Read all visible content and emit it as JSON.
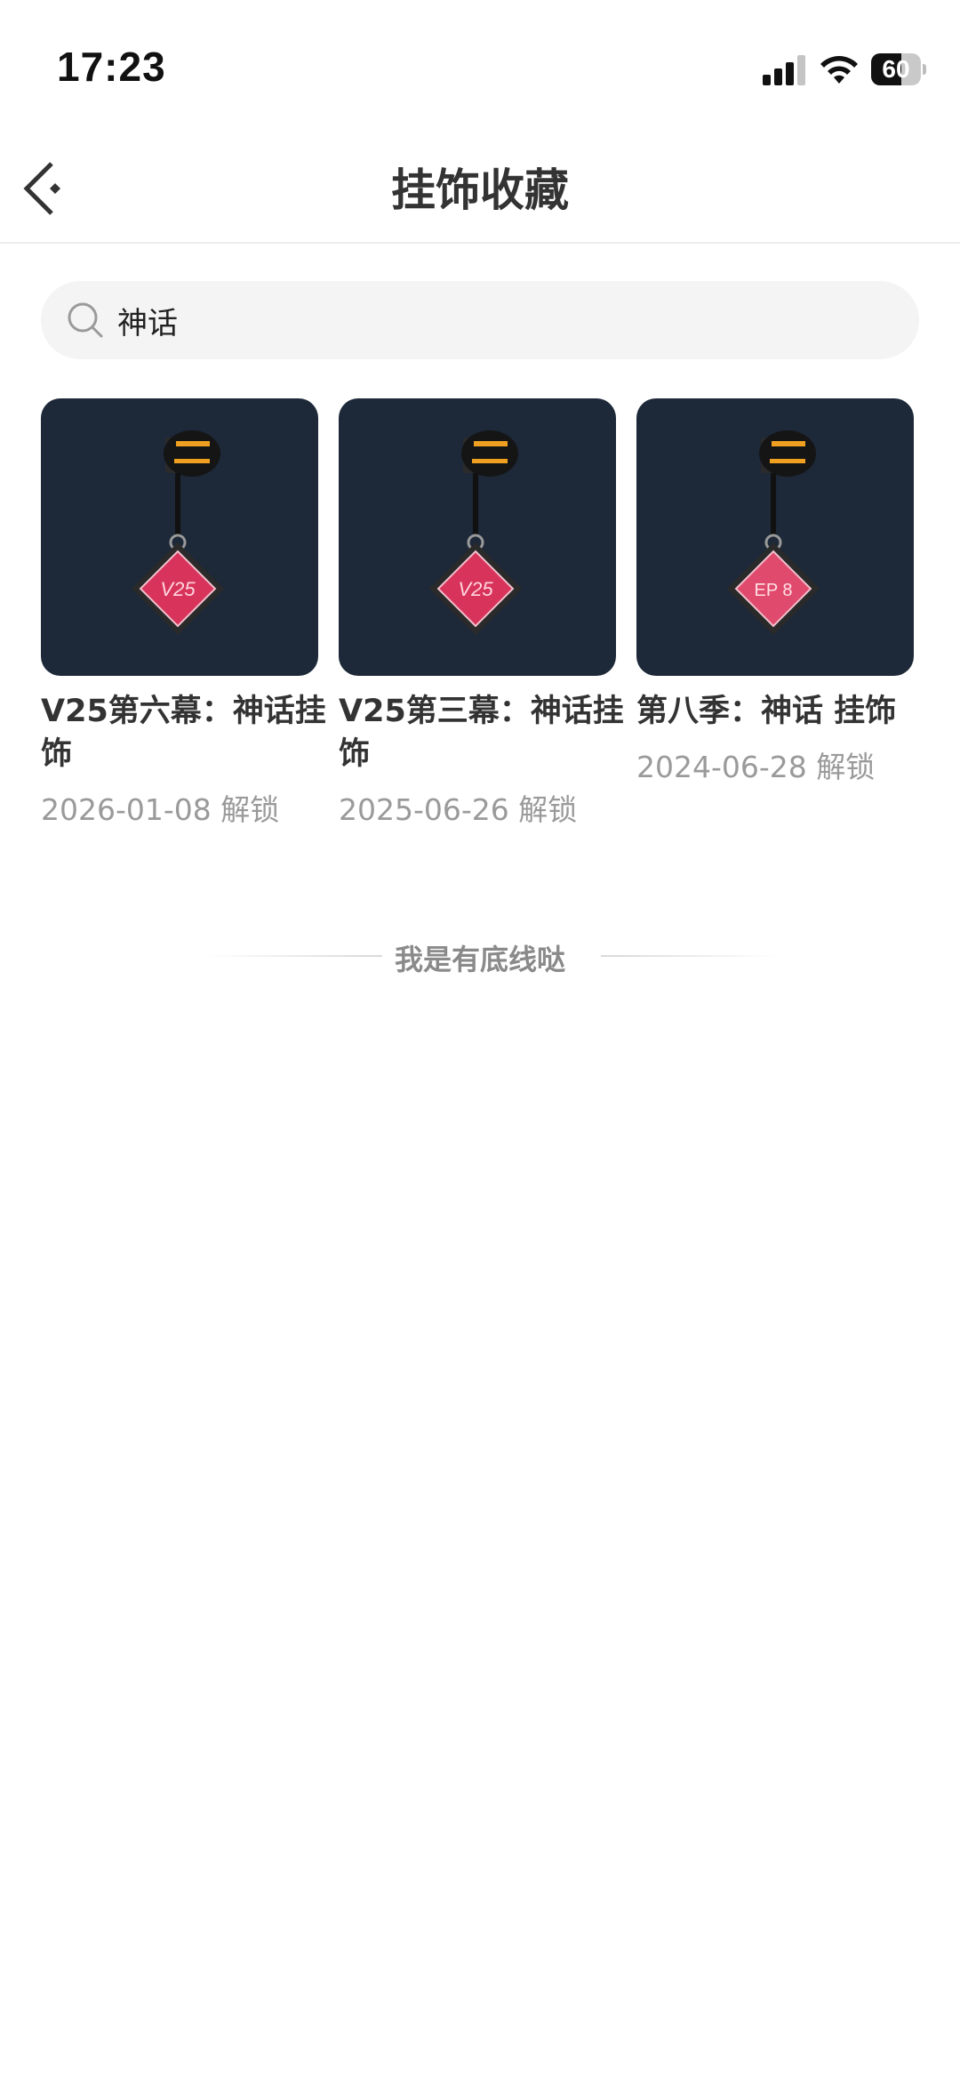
{
  "status_bar": {
    "time": "17:23",
    "battery_percent": "60",
    "battery_level": 0.6,
    "signal_icon": "cellular-signal-icon",
    "wifi_icon": "wifi-icon"
  },
  "nav": {
    "title": "挂饰收藏",
    "back_icon": "chevron-left-icon"
  },
  "search": {
    "icon": "search-icon",
    "value": "神话"
  },
  "items": [
    {
      "title": "V25第六幕：神话挂饰",
      "date": "2026-01-08 解锁",
      "charm_label": "V25"
    },
    {
      "title": "V25第三幕：神话挂饰",
      "date": "2025-06-26 解锁",
      "charm_label": "V25"
    },
    {
      "title": "第八季：神话 挂饰",
      "date": "2024-06-28 解锁",
      "charm_label": "EP 8"
    }
  ],
  "footer": {
    "bottom_text": "我是有底线哒"
  },
  "colors": {
    "thumb_bg": "#1d2838",
    "charm_red": "#d8335a",
    "charm_ring": "#f0a020"
  }
}
